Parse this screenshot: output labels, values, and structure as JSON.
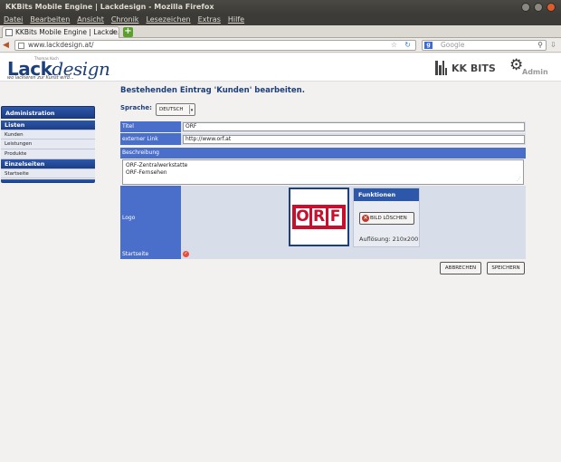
{
  "window": {
    "title": "KKBits Mobile Engine | Lackdesign - Mozilla Firefox"
  },
  "menu": [
    "Datei",
    "Bearbeiten",
    "Ansicht",
    "Chronik",
    "Lesezeichen",
    "Extras",
    "Hilfe"
  ],
  "tab": {
    "label": "KKBits Mobile Engine | Lackde...",
    "close": "×"
  },
  "nav": {
    "url": "www.lackdesign.at/",
    "search_placeholder": "Google"
  },
  "header": {
    "logo_top": "Thomas Koch",
    "logo_bold": "Lack",
    "logo_italic": "design",
    "tagline": "wo lackieren zur Kunst wird...",
    "brand": "KK BITS",
    "admin": "Admin"
  },
  "sidebar": {
    "header": "Administration",
    "sections": [
      {
        "title": "Listen",
        "items": [
          "Kunden",
          "Leistungen",
          "Produkte"
        ]
      },
      {
        "title": "Einzelseiten",
        "items": [
          "Startseite"
        ]
      }
    ]
  },
  "form": {
    "heading": "Bestehenden Eintrag 'Kunden' bearbeiten.",
    "language_label": "Sprache:",
    "language_value": "DEUTSCH",
    "fields": {
      "titel_label": "Titel",
      "titel_value": "ORF",
      "link_label": "externer Link",
      "link_value": "http://www.orf.at",
      "desc_label": "Beschreibung",
      "desc_lines": [
        "ORF-Zentralwerkstatte",
        "ORF-Fernsehen"
      ],
      "logo_label": "Logo",
      "start_label": "Startseite"
    },
    "logo_letters": [
      "O",
      "R",
      "F"
    ],
    "functions": {
      "header": "Funktionen",
      "delete_label": "BILD LÖSCHEN",
      "resolution": "Auflösung: 210x200"
    },
    "buttons": {
      "cancel": "ABBRECHEN",
      "save": "SPEICHERN"
    }
  },
  "colors": {
    "brand_blue": "#1d3f7a",
    "label_blue": "#4a6fca",
    "field_bg": "#d7dde9",
    "orf_red": "#c8102e"
  }
}
